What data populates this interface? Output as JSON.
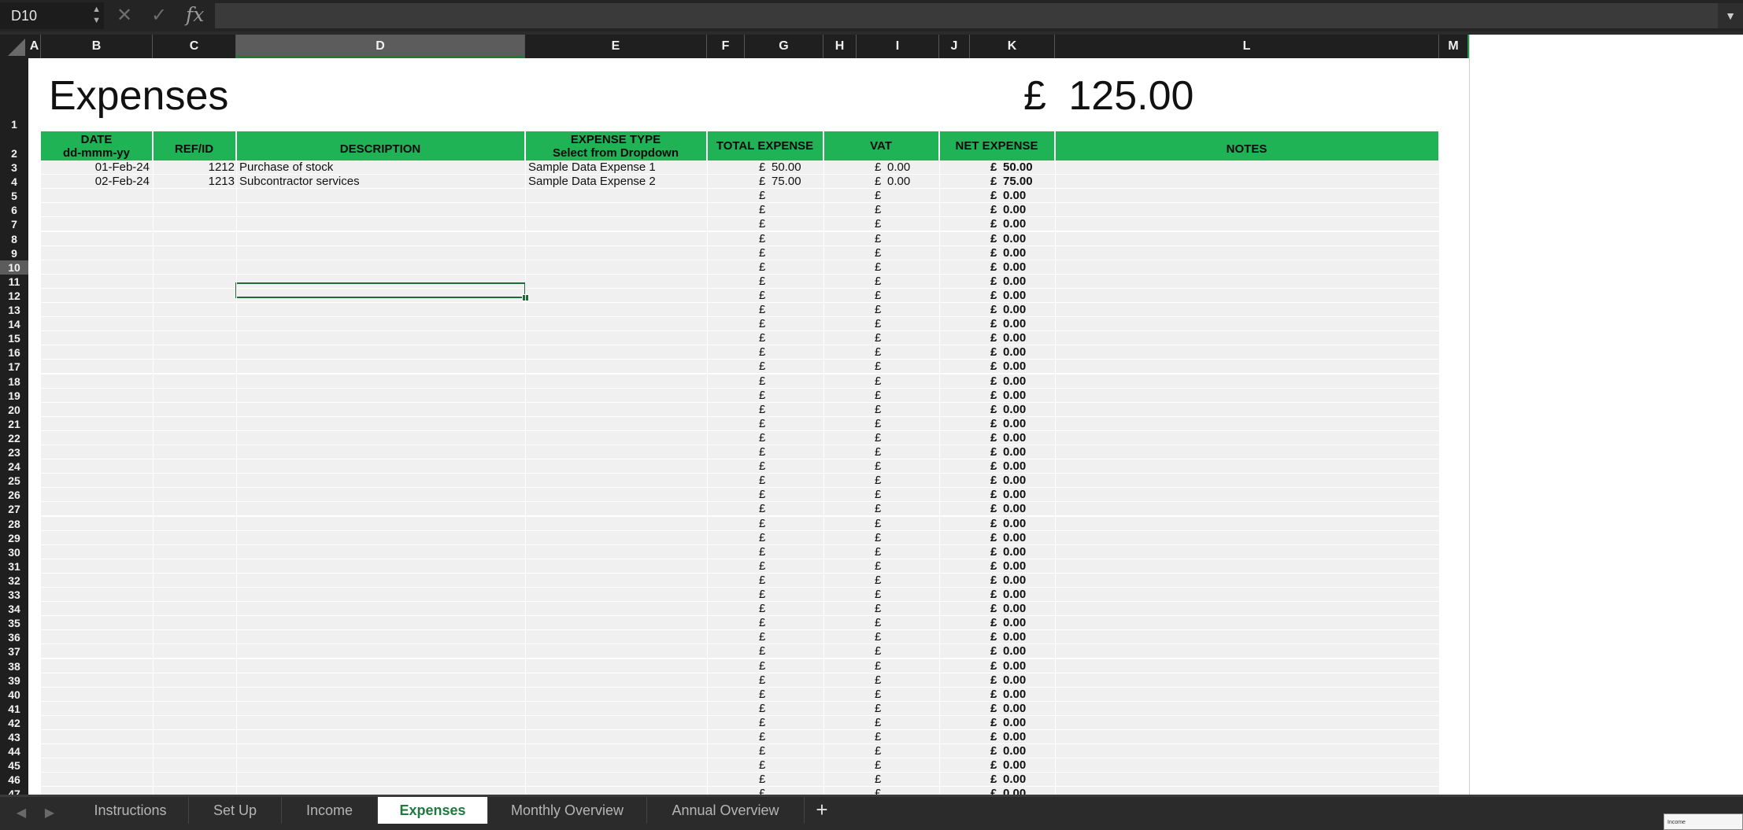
{
  "formula_bar": {
    "name_box": "D10",
    "cancel_icon": "close-icon",
    "confirm_icon": "check-icon",
    "fx_label": "fx",
    "formula": ""
  },
  "columns": [
    "A",
    "B",
    "C",
    "D",
    "E",
    "F",
    "G",
    "H",
    "I",
    "J",
    "K",
    "L",
    "M"
  ],
  "selected_column": "D",
  "rows": [
    "1",
    "2",
    "3",
    "4",
    "5",
    "6",
    "7",
    "8",
    "9",
    "10",
    "11",
    "12",
    "13",
    "14",
    "15",
    "16",
    "17",
    "18",
    "19",
    "20",
    "21",
    "22",
    "23",
    "24",
    "25",
    "26",
    "27",
    "28",
    "29",
    "30",
    "31",
    "32",
    "33",
    "34",
    "35",
    "36",
    "37",
    "38",
    "39",
    "40",
    "41",
    "42",
    "43",
    "44",
    "45",
    "46",
    "47"
  ],
  "selected_row": "10",
  "sheet": {
    "title": "Expenses",
    "total_currency": "£",
    "total_value": "125.00",
    "headers": {
      "date_line1": "DATE",
      "date_line2": "dd-mmm-yy",
      "ref": "REF/ID",
      "description": "DESCRIPTION",
      "type_line1": "EXPENSE TYPE",
      "type_line2": "Select from Dropdown",
      "total": "TOTAL EXPENSE",
      "vat": "VAT",
      "net": "NET EXPENSE",
      "notes": "NOTES"
    },
    "data_rows": [
      {
        "date": "01-Feb-24",
        "ref": "1212",
        "description": "Purchase of stock",
        "type": "Sample Data Expense 1",
        "total": "50.00",
        "vat": "0.00",
        "net": "50.00"
      },
      {
        "date": "02-Feb-24",
        "ref": "1213",
        "description": "Subcontractor services",
        "type": "Sample Data Expense 2",
        "total": "75.00",
        "vat": "0.00",
        "net": "75.00"
      }
    ],
    "currency_symbol": "£",
    "empty_net": "0.00"
  },
  "tabs": [
    {
      "label": "Instructions",
      "active": false
    },
    {
      "label": "Set Up",
      "active": false
    },
    {
      "label": "Income",
      "active": false
    },
    {
      "label": "Expenses",
      "active": true
    },
    {
      "label": "Monthly Overview",
      "active": false
    },
    {
      "label": "Annual Overview",
      "active": false
    }
  ],
  "add_tab_label": "+",
  "thumbnail_text": "Income"
}
